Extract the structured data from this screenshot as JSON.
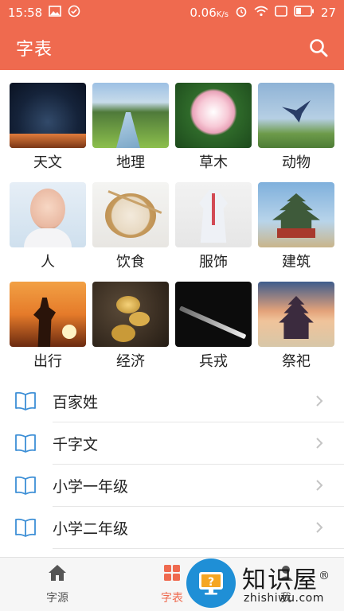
{
  "status_bar": {
    "time": "15:58",
    "network_speed": "0.06",
    "network_unit": "K/s",
    "battery": "27",
    "icons": [
      "image-icon",
      "check-circle-icon",
      "alarm-icon",
      "wifi-icon",
      "sim-icon",
      "battery-icon"
    ]
  },
  "app_bar": {
    "title": "字表",
    "search_icon": "search-icon"
  },
  "categories": [
    {
      "label": "天文",
      "image": "star-trails"
    },
    {
      "label": "地理",
      "image": "valley-river"
    },
    {
      "label": "草木",
      "image": "dahlia-flower"
    },
    {
      "label": "动物",
      "image": "swallow-bird"
    },
    {
      "label": "人",
      "image": "baby"
    },
    {
      "label": "饮食",
      "image": "dumplings"
    },
    {
      "label": "服饰",
      "image": "hanfu-robe"
    },
    {
      "label": "建筑",
      "image": "pagoda-tower"
    },
    {
      "label": "出行",
      "image": "horse-rider-sunset"
    },
    {
      "label": "经济",
      "image": "gold-ingots"
    },
    {
      "label": "兵戎",
      "image": "sword"
    },
    {
      "label": "祭祀",
      "image": "temple-of-heaven"
    }
  ],
  "list": [
    {
      "label": "百家姓",
      "icon": "book-icon"
    },
    {
      "label": "千字文",
      "icon": "book-icon"
    },
    {
      "label": "小学一年级",
      "icon": "book-icon"
    },
    {
      "label": "小学二年级",
      "icon": "book-icon"
    }
  ],
  "bottom_nav": {
    "items": [
      {
        "label": "字源",
        "icon": "home-icon",
        "active": false
      },
      {
        "label": "字表",
        "icon": "grid-icon",
        "active": true
      },
      {
        "label": "我",
        "icon": "person-icon",
        "active": false
      }
    ],
    "active_color": "#ef6a4f"
  },
  "watermark": {
    "title": "知识屋",
    "registered": "®",
    "site": "zhishiwu.com"
  },
  "colors": {
    "primary": "#ef6a4f",
    "book_icon": "#3d8fd6"
  }
}
